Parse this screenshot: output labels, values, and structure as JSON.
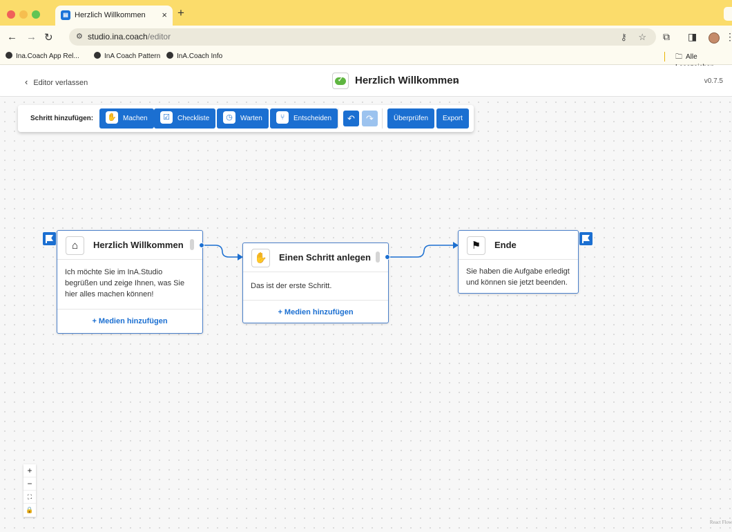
{
  "browser": {
    "tab_title": "Herzlich Willkommen",
    "tab_close": "×",
    "new_tab": "+",
    "url_host": "studio.ina.coach",
    "url_path": "/editor",
    "bookmarks": [
      "Ina.Coach App Rel...",
      "InA Coach Pattern",
      "InA.Coach Info"
    ],
    "all_bookmarks": "Alle Lesezeichen"
  },
  "header": {
    "back_label": "Editor verlassen",
    "title": "Herzlich Willkommen",
    "version": "v0.7.5"
  },
  "toolbar": {
    "add_step_label": "Schritt hinzufügen:",
    "buttons": {
      "machen": "Machen",
      "checkliste": "Checkliste",
      "warten": "Warten",
      "entscheiden": "Entscheiden",
      "ueberpruefen": "Überprüfen",
      "export": "Export"
    }
  },
  "nodes": [
    {
      "title": "Herzlich Willkommen",
      "icon": "home-icon",
      "body": [
        "Ich möchte Sie im InA.Studio",
        "begrüßen und zeige Ihnen, was Sie",
        "hier alles machen können!"
      ],
      "footer": "+ Medien hinzufügen"
    },
    {
      "title": "Einen Schritt anlegen",
      "icon": "hand-icon",
      "body": [
        "Das ist der erste Schritt."
      ],
      "footer": "+ Medien hinzufügen"
    },
    {
      "title": "Ende",
      "icon": "flag-icon",
      "body": [
        "Sie haben die Aufgabe erledigt",
        "und können sie jetzt beenden."
      ]
    }
  ],
  "zoom_controls": [
    "+",
    "−",
    "⛶",
    "🔒"
  ],
  "attribution": "React Flow",
  "colors": {
    "accent": "#1b6fd1",
    "tabbar": "#fbdc6b",
    "node_border": "#4a7fc9"
  }
}
